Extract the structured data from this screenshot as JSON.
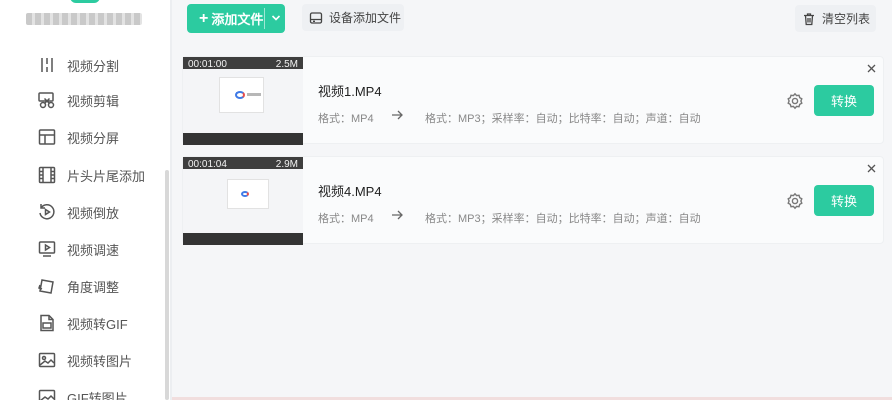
{
  "sidebar": {
    "items": [
      {
        "label": "视频分割",
        "icon": "split-icon"
      },
      {
        "label": "视频剪辑",
        "icon": "scissors-icon"
      },
      {
        "label": "视频分屏",
        "icon": "split-screen-icon"
      },
      {
        "label": "片头片尾添加",
        "icon": "film-icon"
      },
      {
        "label": "视频倒放",
        "icon": "reverse-icon"
      },
      {
        "label": "视频调速",
        "icon": "speed-icon"
      },
      {
        "label": "角度调整",
        "icon": "rotate-icon"
      },
      {
        "label": "视频转GIF",
        "icon": "gif-icon"
      },
      {
        "label": "视频转图片",
        "icon": "image-icon"
      },
      {
        "label": "GIF转图片",
        "icon": "gif-image-icon"
      }
    ]
  },
  "toolbar": {
    "add_file": "添加文件",
    "device_add": "设备添加文件",
    "clear_list": "清空列表"
  },
  "files": [
    {
      "duration": "00:01:00",
      "size": "2.5M",
      "name": "视频1.MP4",
      "source_format": "格式：MP4",
      "target_format": "格式：MP3；采样率：自动；比特率：自动；声道：自动",
      "convert_label": "转换"
    },
    {
      "duration": "00:01:04",
      "size": "2.9M",
      "name": "视频4.MP4",
      "source_format": "格式：MP4",
      "target_format": "格式：MP3；采样率：自动；比特率：自动；声道：自动",
      "convert_label": "转换"
    }
  ],
  "colors": {
    "accent": "#2ccba0",
    "sidebar_bg": "#ffffff",
    "page_bg": "#f5f6f8"
  }
}
